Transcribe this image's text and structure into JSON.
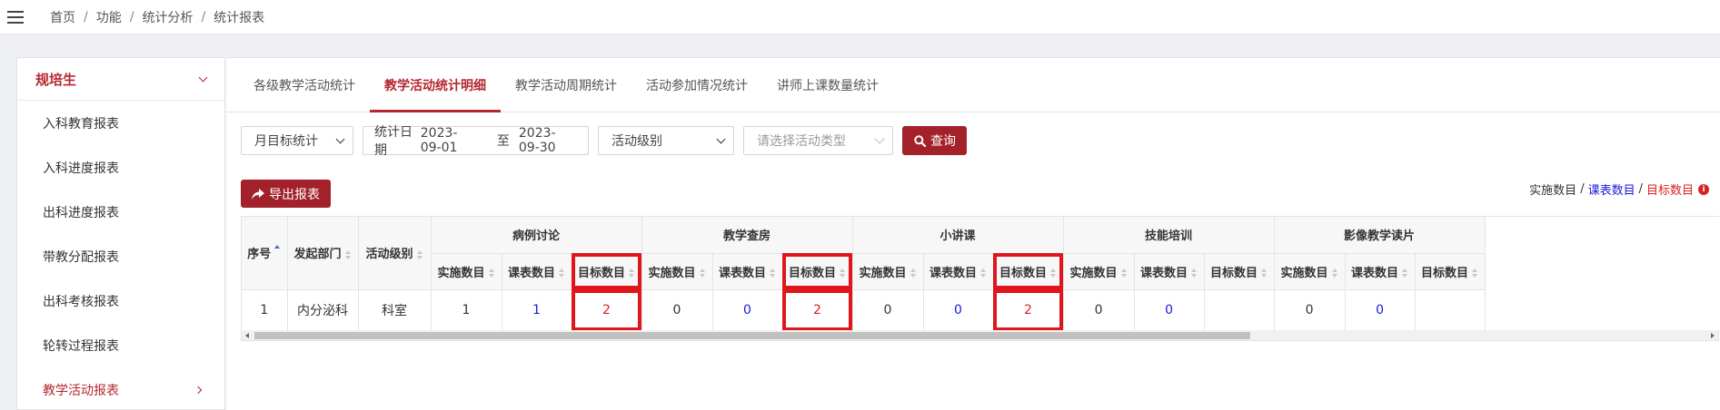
{
  "topbar": {
    "breadcrumb": [
      "首页",
      "功能",
      "统计分析",
      "统计报表"
    ],
    "separator": "/"
  },
  "sidebar": {
    "title": "规培生",
    "items": [
      {
        "label": "入科教育报表",
        "active": false
      },
      {
        "label": "入科进度报表",
        "active": false
      },
      {
        "label": "出科进度报表",
        "active": false
      },
      {
        "label": "带教分配报表",
        "active": false
      },
      {
        "label": "出科考核报表",
        "active": false
      },
      {
        "label": "轮转过程报表",
        "active": false
      },
      {
        "label": "教学活动报表",
        "active": true
      }
    ]
  },
  "tabs": [
    {
      "label": "各级教学活动统计",
      "active": false
    },
    {
      "label": "教学活动统计明细",
      "active": true
    },
    {
      "label": "教学活动周期统计",
      "active": false
    },
    {
      "label": "活动参加情况统计",
      "active": false
    },
    {
      "label": "讲师上课数量统计",
      "active": false
    }
  ],
  "filters": {
    "period_select": "月目标统计",
    "date_label": "统计日期",
    "date_start": "2023-09-01",
    "date_to": "至",
    "date_end": "2023-09-30",
    "level_select": "活动级别",
    "type_placeholder": "请选择活动类型",
    "query_button": "查询"
  },
  "export_button": "导出报表",
  "legend": {
    "implemented": "实施数目",
    "course": "课表数目",
    "target": "目标数目",
    "separator": "/"
  },
  "colors": {
    "brand": "#a3212b",
    "course_blue": "#1a1adb",
    "target_red": "#d92121",
    "highlight_box": "#e0161c"
  },
  "table": {
    "fixed_headers": [
      "序号",
      "发起部门",
      "活动级别"
    ],
    "groups": [
      "病例讨论",
      "教学查房",
      "小讲课",
      "技能培训",
      "影像教学读片"
    ],
    "sub_headers": [
      "实施数目",
      "课表数目",
      "目标数目"
    ],
    "rows": [
      {
        "index": "1",
        "department": "内分泌科",
        "level": "科室",
        "cells": [
          "1",
          "1",
          "2",
          "0",
          "0",
          "2",
          "0",
          "0",
          "2",
          "0",
          "0",
          "",
          "0",
          "0",
          ""
        ]
      }
    ],
    "highlighted_columns": [
      "病例讨论-目标数目",
      "教学查房-目标数目",
      "小讲课-目标数目"
    ]
  }
}
